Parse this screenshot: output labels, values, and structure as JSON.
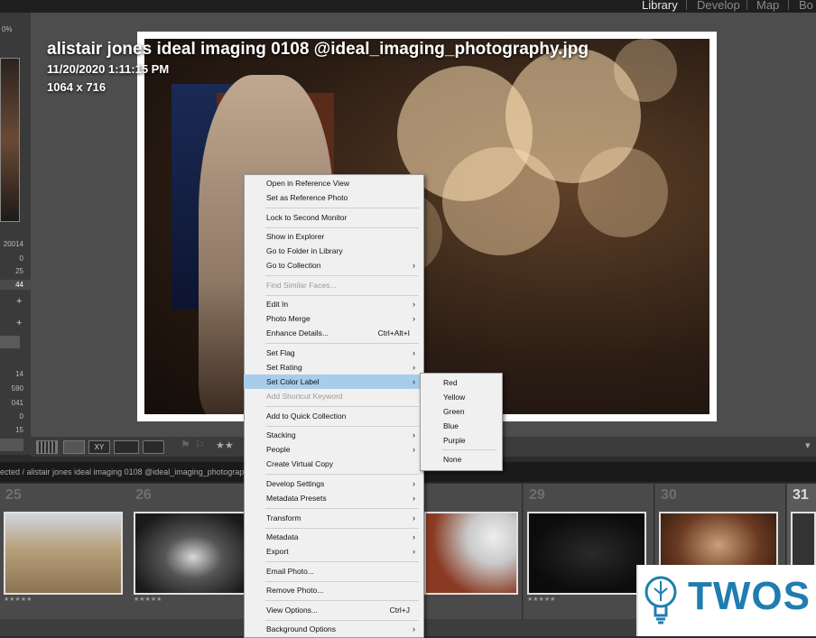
{
  "modules": [
    {
      "label": "Library",
      "active": true
    },
    {
      "label": "Develop",
      "active": false
    },
    {
      "label": "Map",
      "active": false
    },
    {
      "label": "Bo",
      "active": false
    }
  ],
  "overlay": {
    "filename": "alistair jones ideal imaging 0108 @ideal_imaging_photography.jpg",
    "datetime": "11/20/2020 1:11:15 PM",
    "dimensions": "1064 x 716"
  },
  "left_panel": {
    "top_label": "0%",
    "numbers": [
      "20014",
      "0",
      "25",
      "44",
      "14",
      "590",
      "041",
      "0",
      "15"
    ]
  },
  "filmstrip": {
    "path": "ected / alistair jones ideal imaging 0108 @ideal_imaging_photograph",
    "cells": [
      {
        "number": "25",
        "stars": "★★★★★"
      },
      {
        "number": "26",
        "stars": "★★★★★"
      },
      {
        "number": "29",
        "stars": "★★★★★"
      },
      {
        "number": "30",
        "stars": ""
      },
      {
        "number": "31",
        "stars": ""
      }
    ]
  },
  "context_menu": {
    "items": [
      {
        "label": "Open in Reference View"
      },
      {
        "label": "Set as Reference Photo"
      },
      {
        "label": "Lock to Second Monitor"
      },
      {
        "label": "Show in Explorer"
      },
      {
        "label": "Go to Folder in Library"
      },
      {
        "label": "Go to Collection",
        "submenu": true
      },
      {
        "label": "Find Similar Faces...",
        "disabled": true
      },
      {
        "label": "Edit In",
        "submenu": true
      },
      {
        "label": "Photo Merge",
        "submenu": true
      },
      {
        "label": "Enhance Details...",
        "shortcut": "Ctrl+Alt+I"
      },
      {
        "label": "Set Flag",
        "submenu": true
      },
      {
        "label": "Set Rating",
        "submenu": true
      },
      {
        "label": "Set Color Label",
        "submenu": true,
        "highlighted": true
      },
      {
        "label": "Add Shortcut Keyword",
        "disabled": true
      },
      {
        "label": "Add to Quick Collection"
      },
      {
        "label": "Stacking",
        "submenu": true
      },
      {
        "label": "People",
        "submenu": true
      },
      {
        "label": "Create Virtual Copy"
      },
      {
        "label": "Develop Settings",
        "submenu": true
      },
      {
        "label": "Metadata Presets",
        "submenu": true
      },
      {
        "label": "Transform",
        "submenu": true
      },
      {
        "label": "Metadata",
        "submenu": true
      },
      {
        "label": "Export",
        "submenu": true
      },
      {
        "label": "Email Photo..."
      },
      {
        "label": "Remove Photo..."
      },
      {
        "label": "View Options...",
        "shortcut": "Ctrl+J"
      },
      {
        "label": "Background Options",
        "submenu": true
      }
    ],
    "submenu_arrow": "›"
  },
  "color_label_submenu": [
    "Red",
    "Yellow",
    "Green",
    "Blue",
    "Purple",
    "None"
  ],
  "logo": {
    "text": "TWOS"
  },
  "colors": {
    "highlight": "#a8cdea",
    "logo": "#1f7db0"
  }
}
